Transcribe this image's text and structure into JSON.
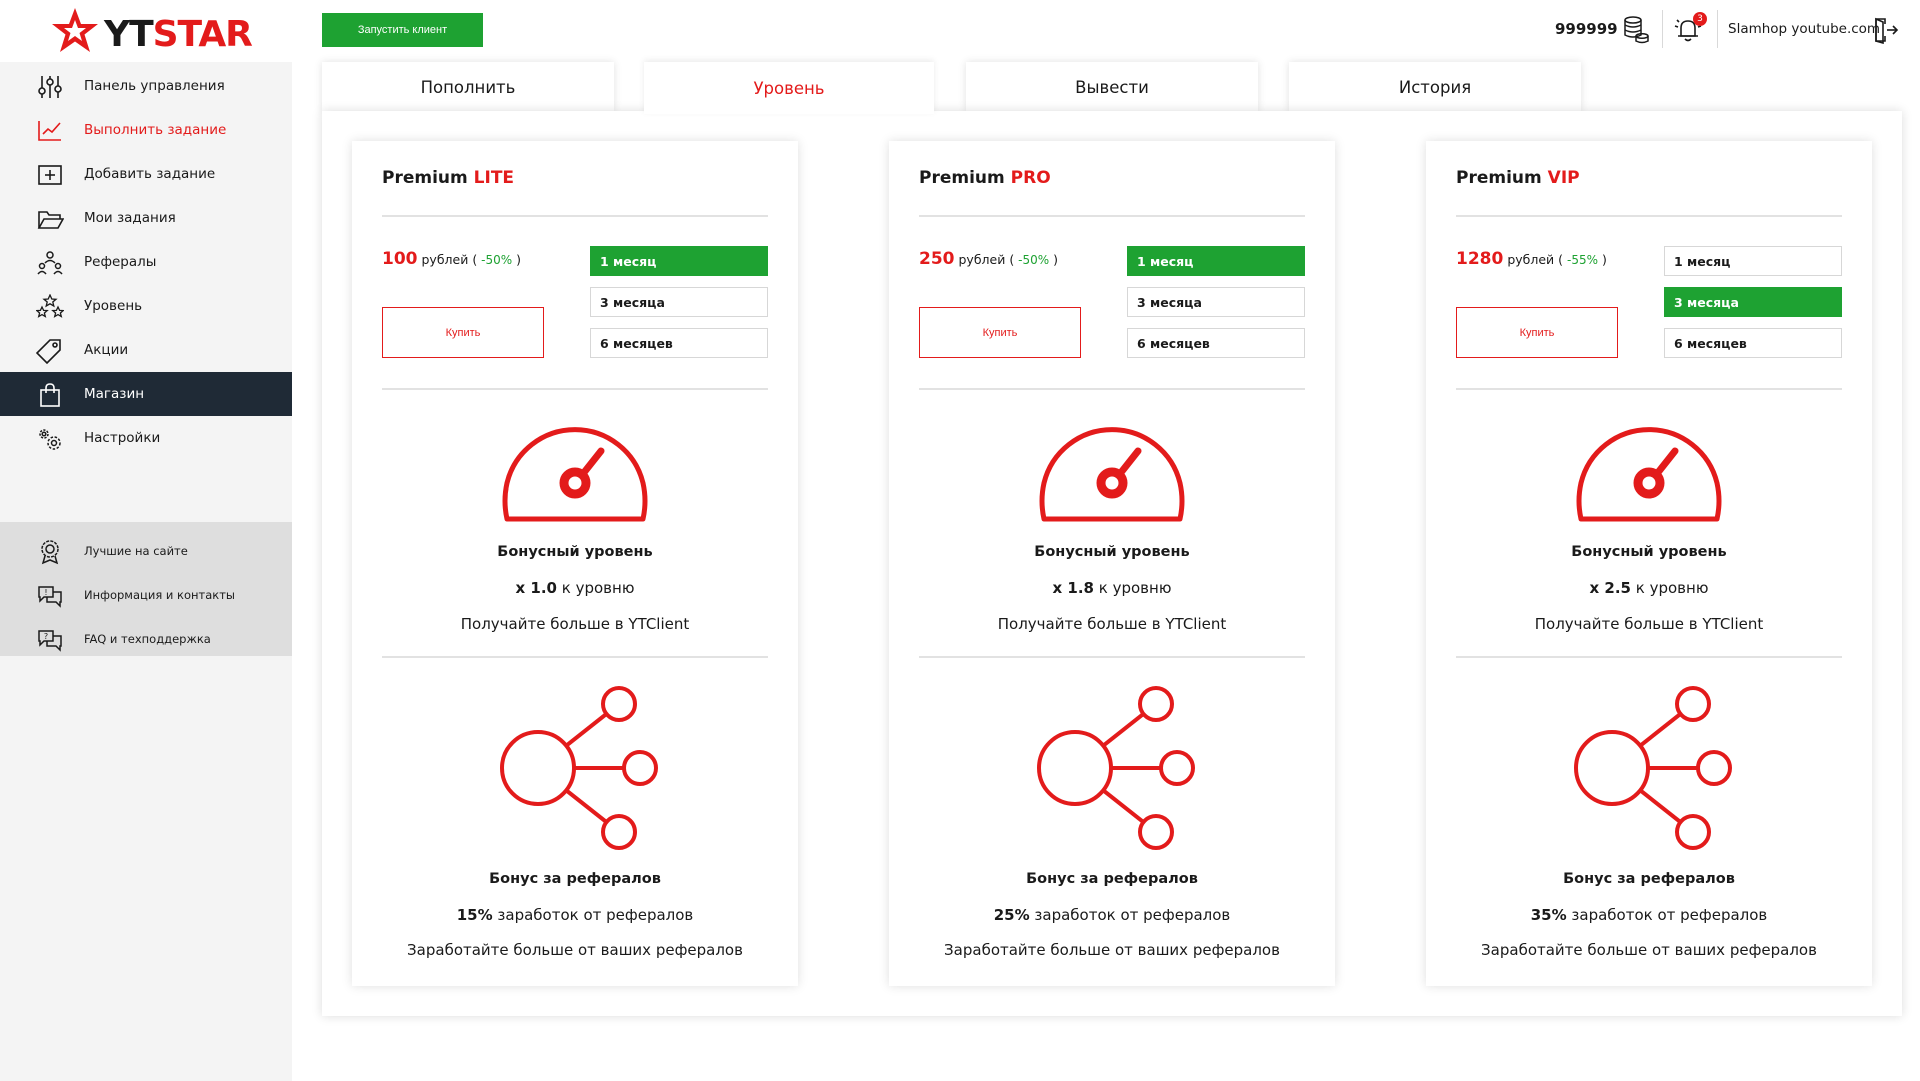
{
  "brand": {
    "name_prefix": "YT",
    "name_suffix": "STAR",
    "accent_color": "#e31b1b",
    "success_color": "#1ea232"
  },
  "sidebar": {
    "items": [
      {
        "label": "Панель управления",
        "icon": "sliders-icon"
      },
      {
        "label": "Выполнить задание",
        "icon": "chart-check-icon",
        "highlighted": true
      },
      {
        "label": "Добавить задание",
        "icon": "add-task-icon"
      },
      {
        "label": "Мои задания",
        "icon": "folder-icon"
      },
      {
        "label": "Рефералы",
        "icon": "referrals-icon"
      },
      {
        "label": "Уровень",
        "icon": "stars-icon"
      },
      {
        "label": "Акции",
        "icon": "tag-icon"
      },
      {
        "label": "Магазин",
        "icon": "shopping-bag-icon",
        "active": true
      },
      {
        "label": "Настройки",
        "icon": "gears-icon"
      }
    ],
    "bottom_items": [
      {
        "label": "Лучшие на сайте",
        "icon": "award-icon"
      },
      {
        "label": "Информация и контакты",
        "icon": "info-chat-icon"
      },
      {
        "label": "FAQ и техподдержка",
        "icon": "faq-chat-icon"
      }
    ]
  },
  "header": {
    "launch_label": "Запустить клиент",
    "balance": "999999",
    "notifications_count": "3",
    "username": "Slamhop youtube.com"
  },
  "tabs": [
    {
      "label": "Пополнить"
    },
    {
      "label": "Уровень",
      "active": true
    },
    {
      "label": "Вывести"
    },
    {
      "label": "История"
    }
  ],
  "cards": [
    {
      "title_prefix": "Premium",
      "title_tier": "LITE",
      "price": "100",
      "currency": "рублей",
      "discount": "-50%",
      "buy_label": "Купить",
      "periods": [
        "1 месяц",
        "3 месяца",
        "6 месяцев"
      ],
      "selected_period": 0,
      "bonus_level_title": "Бонусный уровень",
      "multiplier": "x 1.0",
      "multiplier_suffix": "к уровню",
      "level_hint": "Получайте больше в YTClient",
      "referral_title": "Бонус за рефералов",
      "referral_percent": "15%",
      "referral_suffix": "заработок от рефералов",
      "referral_hint": "Заработайте больше от ваших рефералов"
    },
    {
      "title_prefix": "Premium",
      "title_tier": "PRO",
      "price": "250",
      "currency": "рублей",
      "discount": "-50%",
      "buy_label": "Купить",
      "periods": [
        "1 месяц",
        "3 месяца",
        "6 месяцев"
      ],
      "selected_period": 0,
      "bonus_level_title": "Бонусный уровень",
      "multiplier": "x 1.8",
      "multiplier_suffix": "к уровню",
      "level_hint": "Получайте больше в YTClient",
      "referral_title": "Бонус за рефералов",
      "referral_percent": "25%",
      "referral_suffix": "заработок от рефералов",
      "referral_hint": "Заработайте больше от ваших рефералов"
    },
    {
      "title_prefix": "Premium",
      "title_tier": "VIP",
      "price": "1280",
      "currency": "рублей",
      "discount": "-55%",
      "buy_label": "Купить",
      "periods": [
        "1 месяц",
        "3 месяца",
        "6 месяцев"
      ],
      "selected_period": 1,
      "bonus_level_title": "Бонусный уровень",
      "multiplier": "x 2.5",
      "multiplier_suffix": "к уровню",
      "level_hint": "Получайте больше в YTClient",
      "referral_title": "Бонус за рефералов",
      "referral_percent": "35%",
      "referral_suffix": "заработок от рефералов",
      "referral_hint": "Заработайте больше от ваших рефералов"
    }
  ]
}
